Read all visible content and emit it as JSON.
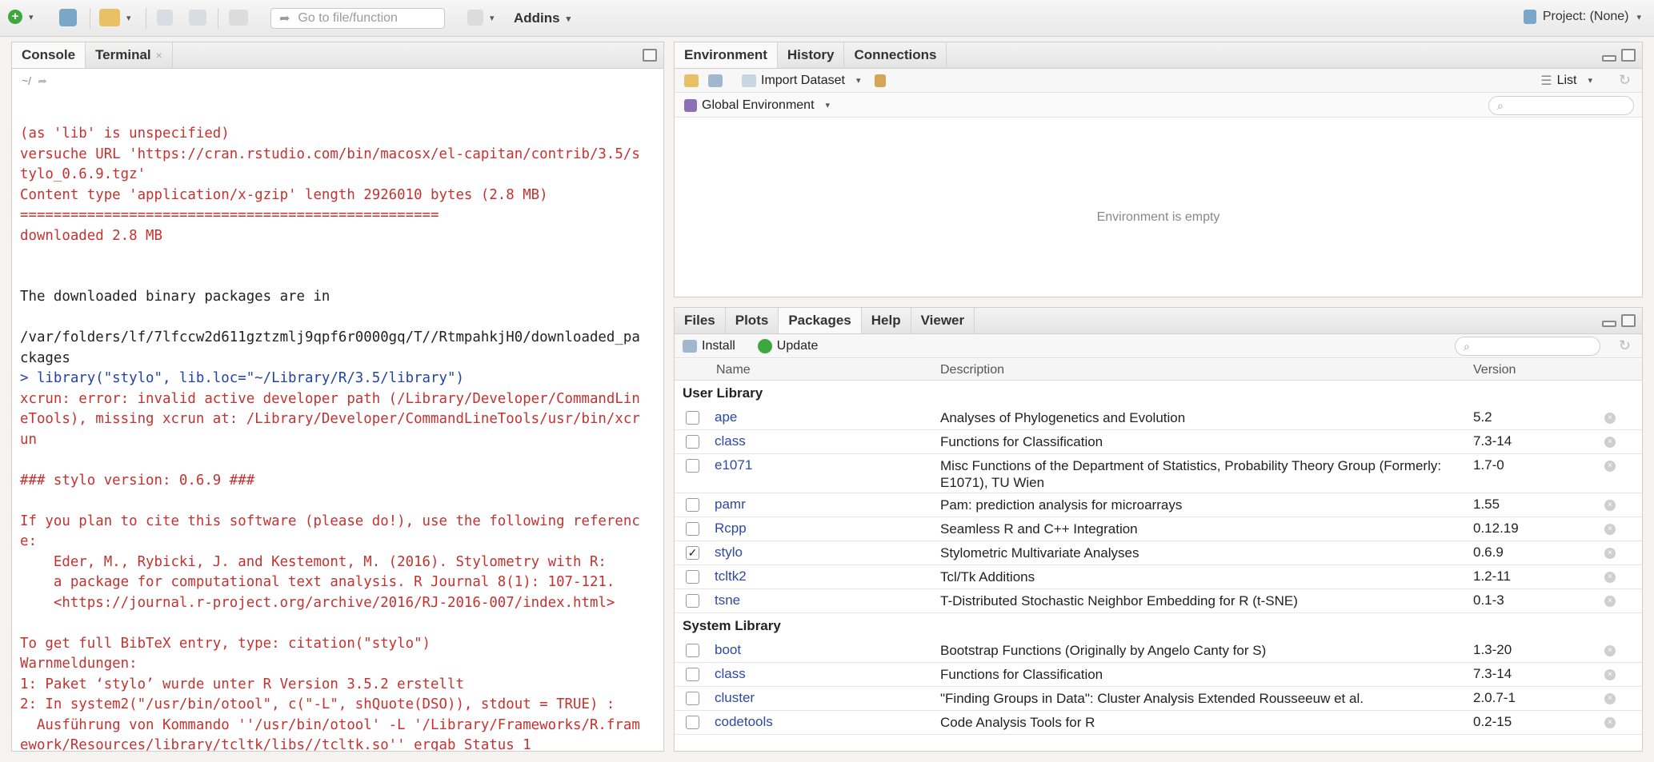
{
  "toolbar": {
    "goto_placeholder": "Go to file/function",
    "addins_label": "Addins",
    "project_label": "Project: (None)"
  },
  "console": {
    "tabs": [
      "Console",
      "Terminal"
    ],
    "path": "~/",
    "lines": [
      {
        "t": "(as 'lib' is unspecified)",
        "c": "red"
      },
      {
        "t": "versuche URL 'https://cran.rstudio.com/bin/macosx/el-capitan/contrib/3.5/s",
        "c": "red"
      },
      {
        "t": "tylo_0.6.9.tgz'",
        "c": "red"
      },
      {
        "t": "Content type 'application/x-gzip' length 2926010 bytes (2.8 MB)",
        "c": "red"
      },
      {
        "t": "==================================================",
        "c": "red"
      },
      {
        "t": "downloaded 2.8 MB",
        "c": "red"
      },
      {
        "t": "",
        "c": "blk"
      },
      {
        "t": "",
        "c": "blk"
      },
      {
        "t": "The downloaded binary packages are in",
        "c": "blk"
      },
      {
        "t": "",
        "c": "blk"
      },
      {
        "t": "/var/folders/lf/7lfccw2d611gztzmlj9qpf6r0000gq/T//RtmpahkjH0/downloaded_pa",
        "c": "blk"
      },
      {
        "t": "ckages",
        "c": "blk"
      },
      {
        "t": "> library(\"stylo\", lib.loc=\"~/Library/R/3.5/library\")",
        "c": "blu"
      },
      {
        "t": "xcrun: error: invalid active developer path (/Library/Developer/CommandLin",
        "c": "red"
      },
      {
        "t": "eTools), missing xcrun at: /Library/Developer/CommandLineTools/usr/bin/xcr",
        "c": "red"
      },
      {
        "t": "un",
        "c": "red"
      },
      {
        "t": "",
        "c": "blk"
      },
      {
        "t": "### stylo version: 0.6.9 ###",
        "c": "red"
      },
      {
        "t": "",
        "c": "blk"
      },
      {
        "t": "If you plan to cite this software (please do!), use the following referenc",
        "c": "red"
      },
      {
        "t": "e:",
        "c": "red"
      },
      {
        "t": "    Eder, M., Rybicki, J. and Kestemont, M. (2016). Stylometry with R:",
        "c": "red"
      },
      {
        "t": "    a package for computational text analysis. R Journal 8(1): 107-121.",
        "c": "red"
      },
      {
        "t": "    <https://journal.r-project.org/archive/2016/RJ-2016-007/index.html>",
        "c": "red"
      },
      {
        "t": "",
        "c": "blk"
      },
      {
        "t": "To get full BibTeX entry, type: citation(\"stylo\")",
        "c": "red"
      },
      {
        "t": "Warnmeldungen:",
        "c": "red"
      },
      {
        "t": "1: Paket ‘stylo’ wurde unter R Version 3.5.2 erstellt",
        "c": "red"
      },
      {
        "t": "2: In system2(\"/usr/bin/otool\", c(\"-L\", shQuote(DSO)), stdout = TRUE) :",
        "c": "red"
      },
      {
        "t": "  Ausführung von Kommando ''/usr/bin/otool' -L '/Library/Frameworks/R.fram",
        "c": "red"
      },
      {
        "t": "ework/Resources/library/tcltk/libs//tcltk.so'' ergab Status 1",
        "c": "red"
      }
    ],
    "prompt": ">"
  },
  "environment": {
    "tabs": [
      "Environment",
      "History",
      "Connections"
    ],
    "import_label": "Import Dataset",
    "list_label": "List",
    "scope_label": "Global Environment",
    "empty_message": "Environment is empty"
  },
  "packages": {
    "tabs": [
      "Files",
      "Plots",
      "Packages",
      "Help",
      "Viewer"
    ],
    "install_label": "Install",
    "update_label": "Update",
    "columns": [
      "Name",
      "Description",
      "Version"
    ],
    "groups": [
      {
        "title": "User Library",
        "rows": [
          {
            "name": "ape",
            "desc": "Analyses of Phylogenetics and Evolution",
            "version": "5.2",
            "checked": false
          },
          {
            "name": "class",
            "desc": "Functions for Classification",
            "version": "7.3-14",
            "checked": false
          },
          {
            "name": "e1071",
            "desc": "Misc Functions of the Department of Statistics, Probability Theory Group (Formerly: E1071), TU Wien",
            "version": "1.7-0",
            "checked": false
          },
          {
            "name": "pamr",
            "desc": "Pam: prediction analysis for microarrays",
            "version": "1.55",
            "checked": false
          },
          {
            "name": "Rcpp",
            "desc": "Seamless R and C++ Integration",
            "version": "0.12.19",
            "checked": false
          },
          {
            "name": "stylo",
            "desc": "Stylometric Multivariate Analyses",
            "version": "0.6.9",
            "checked": true
          },
          {
            "name": "tcltk2",
            "desc": "Tcl/Tk Additions",
            "version": "1.2-11",
            "checked": false
          },
          {
            "name": "tsne",
            "desc": "T-Distributed Stochastic Neighbor Embedding for R (t-SNE)",
            "version": "0.1-3",
            "checked": false
          }
        ]
      },
      {
        "title": "System Library",
        "rows": [
          {
            "name": "boot",
            "desc": "Bootstrap Functions (Originally by Angelo Canty for S)",
            "version": "1.3-20",
            "checked": false
          },
          {
            "name": "class",
            "desc": "Functions for Classification",
            "version": "7.3-14",
            "checked": false
          },
          {
            "name": "cluster",
            "desc": "\"Finding Groups in Data\": Cluster Analysis Extended Rousseeuw et al.",
            "version": "2.0.7-1",
            "checked": false
          },
          {
            "name": "codetools",
            "desc": "Code Analysis Tools for R",
            "version": "0.2-15",
            "checked": false
          }
        ]
      }
    ]
  }
}
